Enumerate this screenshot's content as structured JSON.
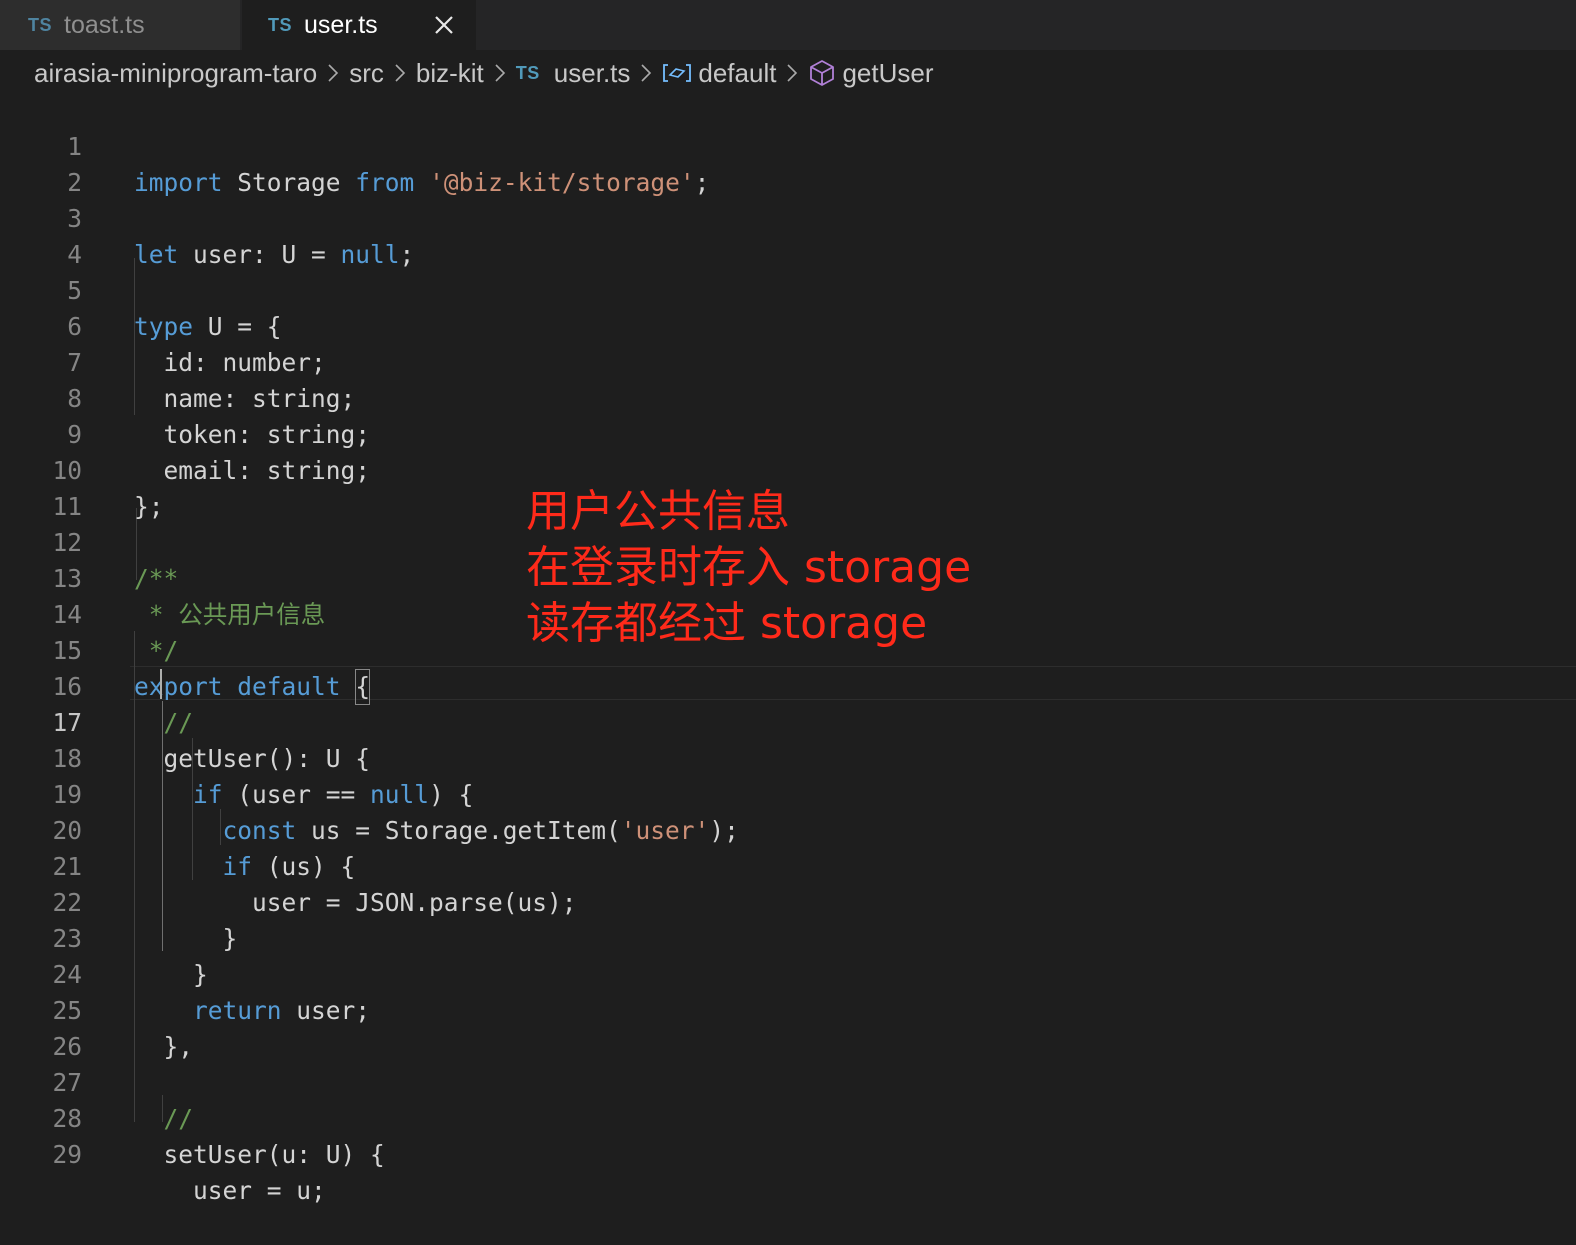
{
  "tabs": [
    {
      "badge": "TS",
      "label": "toast.ts",
      "active": false
    },
    {
      "badge": "TS",
      "label": "user.ts",
      "active": true
    }
  ],
  "breadcrumb": {
    "items": [
      "airasia-miniprogram-taro",
      "src",
      "biz-kit",
      "user.ts",
      "default",
      "getUser"
    ],
    "file_badge": "TS"
  },
  "editor": {
    "current_line": 17,
    "line_numbers": [
      "1",
      "2",
      "3",
      "4",
      "5",
      "6",
      "7",
      "8",
      "9",
      "10",
      "11",
      "12",
      "13",
      "14",
      "15",
      "16",
      "17",
      "18",
      "19",
      "20",
      "21",
      "22",
      "23",
      "24",
      "25",
      "26",
      "27",
      "28",
      "29"
    ],
    "code": {
      "l1": {
        "k1": "import",
        "t1": " Storage ",
        "k2": "from",
        "t2": " ",
        "s1": "'@biz-kit/storage'",
        "t3": ";"
      },
      "l3": {
        "k1": "let",
        "t1": " user: U = ",
        "k2": "null",
        "t2": ";"
      },
      "l5": {
        "k1": "type",
        "t1": " U = {"
      },
      "l6": {
        "t1": "  id: number;"
      },
      "l7": {
        "t1": "  name: string;"
      },
      "l8": {
        "t1": "  token: string;"
      },
      "l9": {
        "t1": "  email: string;"
      },
      "l10": {
        "t1": "};"
      },
      "l12": {
        "c1": "/**"
      },
      "l13": {
        "c1": " * 公共用户信息"
      },
      "l14": {
        "c1": " */"
      },
      "l15": {
        "k1": "export",
        "t1": " ",
        "k2": "default",
        "t2": " ",
        "b1": "{"
      },
      "l16": {
        "c1": "  //"
      },
      "l17": {
        "t1": "  getUser(): U {"
      },
      "l18": {
        "t0": "    ",
        "k1": "if",
        "t1": " (user == ",
        "k2": "null",
        "t2": ") {"
      },
      "l19": {
        "t0": "      ",
        "k1": "const",
        "t1": " us = Storage.getItem(",
        "s1": "'user'",
        "t2": ");"
      },
      "l20": {
        "t0": "      ",
        "k1": "if",
        "t1": " (us) {"
      },
      "l21": {
        "t1": "        user = JSON.parse(us);"
      },
      "l22": {
        "t1": "      }"
      },
      "l23": {
        "t1": "    }"
      },
      "l24": {
        "t0": "    ",
        "k1": "return",
        "t1": " user;"
      },
      "l25": {
        "t1": "  },"
      },
      "l27": {
        "c1": "  //"
      },
      "l28": {
        "t1": "  setUser(u: U) {"
      },
      "l29": {
        "t1": "    user = u;"
      }
    }
  },
  "annotation": {
    "lines": [
      "用户公共信息",
      "在登录时存入 storage",
      "读存都经过 storage"
    ],
    "color": "#ff2a1a"
  },
  "colors": {
    "keyword": "#569cd6",
    "string": "#ce9178",
    "comment": "#6a9955",
    "ts_badge": "#519aba"
  }
}
